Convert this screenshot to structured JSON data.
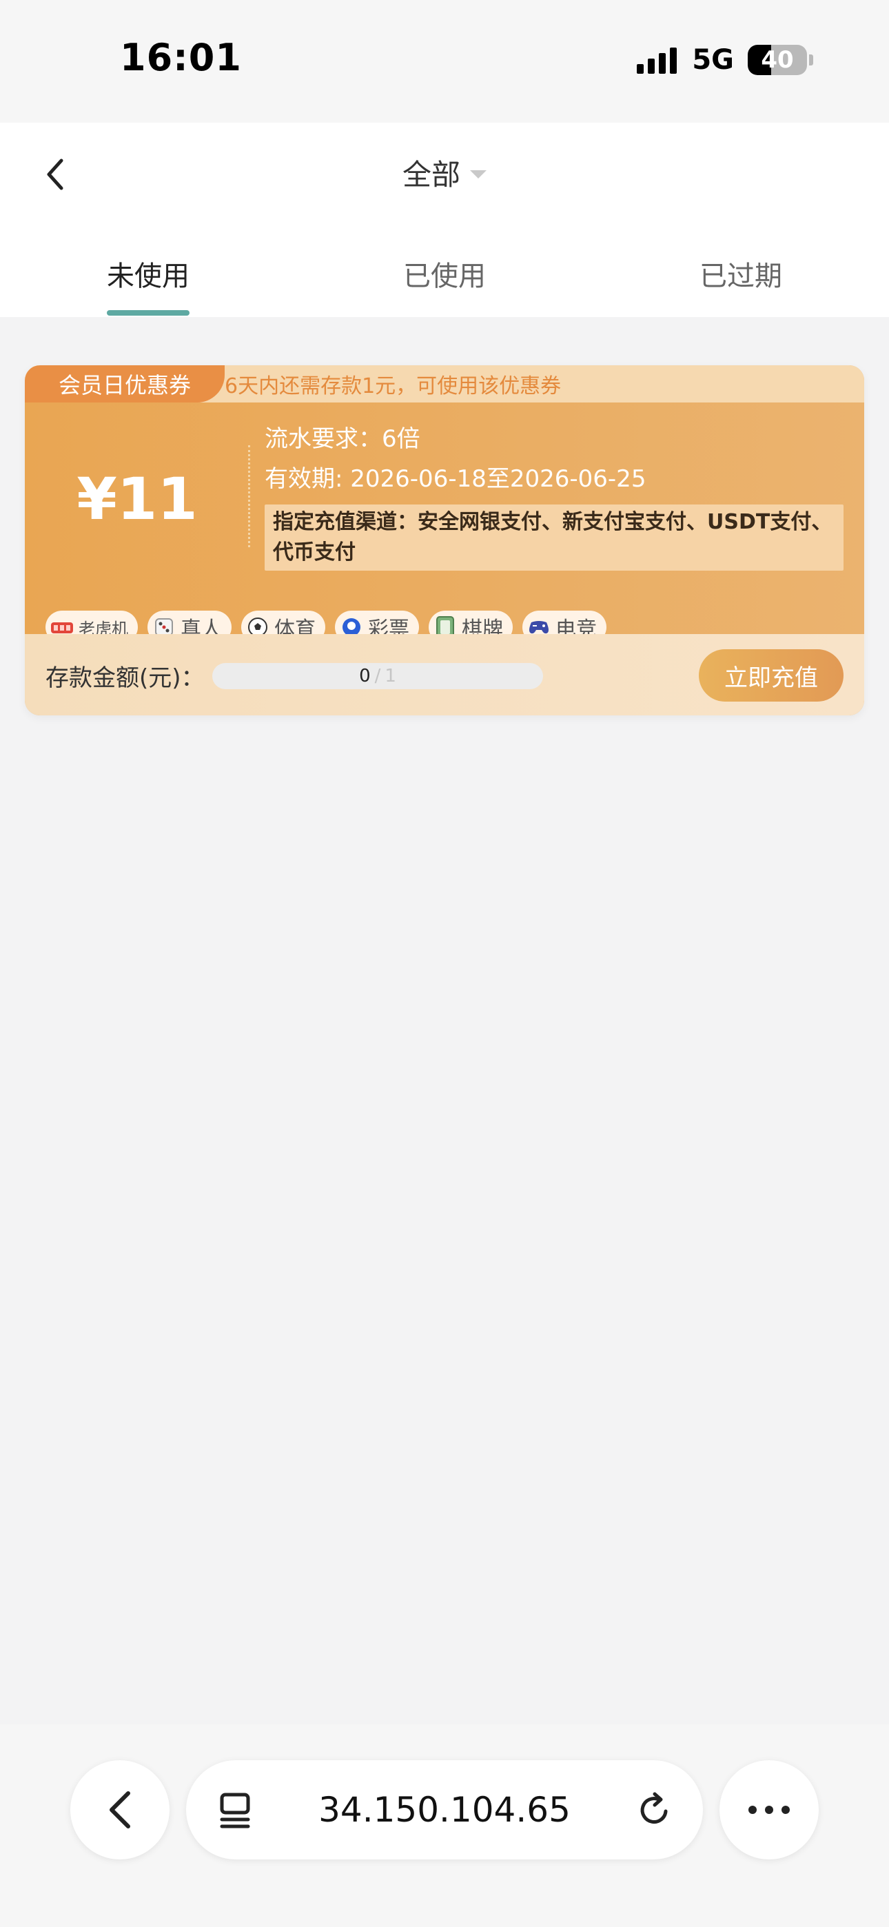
{
  "status_bar": {
    "time": "16:01",
    "network": "5G",
    "battery": "40",
    "battery_level": 0.4
  },
  "header": {
    "title": "全部",
    "back_icon": "chevron-left-icon",
    "dropdown_icon": "caret-down-icon"
  },
  "tabs": [
    {
      "label": "未使用",
      "active": true
    },
    {
      "label": "已使用",
      "active": false
    },
    {
      "label": "已过期",
      "active": false
    }
  ],
  "coupon": {
    "badge": "会员日优惠券",
    "hint": "6天内还需存款1元，可使用该优惠券",
    "amount": "¥11",
    "turnover": "流水要求：6倍",
    "validity": "有效期: 2026-06-18至2026-06-25",
    "channels": "指定充值渠道：安全网银支付、新支付宝支付、USDT支付、代币支付",
    "tags": [
      {
        "label": "老虎机",
        "icon": "slot-machine-icon"
      },
      {
        "label": "真人",
        "icon": "dice-icon"
      },
      {
        "label": "体育",
        "icon": "soccer-ball-icon"
      },
      {
        "label": "彩票",
        "icon": "lottery-ball-icon"
      },
      {
        "label": "棋牌",
        "icon": "mahjong-tile-icon"
      },
      {
        "label": "电竞",
        "icon": "gamepad-icon"
      }
    ],
    "deposit_label": "存款金额(元)：",
    "progress_current": "0",
    "progress_separator": "/",
    "progress_total": "1",
    "progress_fraction": 0,
    "recharge_button": "立即充值",
    "colors": {
      "badge": "#e98f45",
      "body": "#e9a653",
      "button": "#e29a55",
      "hint": "#e48a3d"
    }
  },
  "browser_bar": {
    "url": "34.150.104.65",
    "back_icon": "chevron-left-icon",
    "tabs_icon": "tabs-icon",
    "reload_icon": "reload-icon",
    "more_icon": "more-dots-icon"
  },
  "colors": {
    "tab_indicator": "#5ea9a2",
    "background": "#f3f3f4"
  }
}
